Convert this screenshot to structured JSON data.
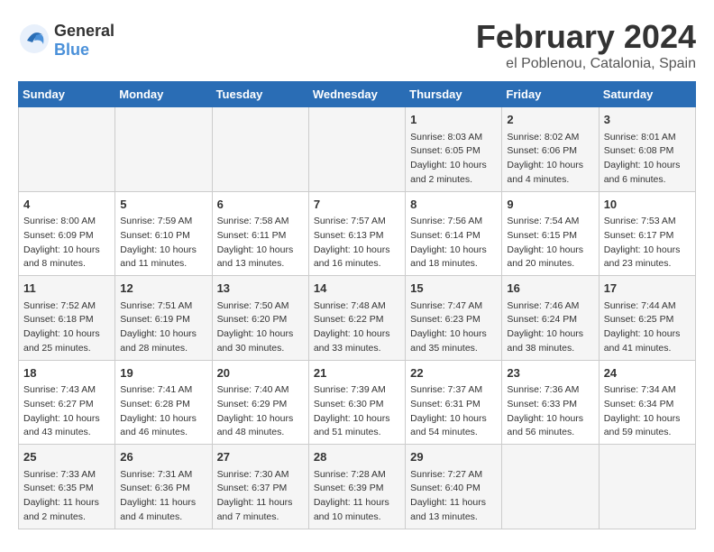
{
  "logo": {
    "general": "General",
    "blue": "Blue"
  },
  "title": "February 2024",
  "subtitle": "el Poblenou, Catalonia, Spain",
  "days_header": [
    "Sunday",
    "Monday",
    "Tuesday",
    "Wednesday",
    "Thursday",
    "Friday",
    "Saturday"
  ],
  "weeks": [
    [
      {
        "day": "",
        "info": ""
      },
      {
        "day": "",
        "info": ""
      },
      {
        "day": "",
        "info": ""
      },
      {
        "day": "",
        "info": ""
      },
      {
        "day": "1",
        "info": "Sunrise: 8:03 AM\nSunset: 6:05 PM\nDaylight: 10 hours\nand 2 minutes."
      },
      {
        "day": "2",
        "info": "Sunrise: 8:02 AM\nSunset: 6:06 PM\nDaylight: 10 hours\nand 4 minutes."
      },
      {
        "day": "3",
        "info": "Sunrise: 8:01 AM\nSunset: 6:08 PM\nDaylight: 10 hours\nand 6 minutes."
      }
    ],
    [
      {
        "day": "4",
        "info": "Sunrise: 8:00 AM\nSunset: 6:09 PM\nDaylight: 10 hours\nand 8 minutes."
      },
      {
        "day": "5",
        "info": "Sunrise: 7:59 AM\nSunset: 6:10 PM\nDaylight: 10 hours\nand 11 minutes."
      },
      {
        "day": "6",
        "info": "Sunrise: 7:58 AM\nSunset: 6:11 PM\nDaylight: 10 hours\nand 13 minutes."
      },
      {
        "day": "7",
        "info": "Sunrise: 7:57 AM\nSunset: 6:13 PM\nDaylight: 10 hours\nand 16 minutes."
      },
      {
        "day": "8",
        "info": "Sunrise: 7:56 AM\nSunset: 6:14 PM\nDaylight: 10 hours\nand 18 minutes."
      },
      {
        "day": "9",
        "info": "Sunrise: 7:54 AM\nSunset: 6:15 PM\nDaylight: 10 hours\nand 20 minutes."
      },
      {
        "day": "10",
        "info": "Sunrise: 7:53 AM\nSunset: 6:17 PM\nDaylight: 10 hours\nand 23 minutes."
      }
    ],
    [
      {
        "day": "11",
        "info": "Sunrise: 7:52 AM\nSunset: 6:18 PM\nDaylight: 10 hours\nand 25 minutes."
      },
      {
        "day": "12",
        "info": "Sunrise: 7:51 AM\nSunset: 6:19 PM\nDaylight: 10 hours\nand 28 minutes."
      },
      {
        "day": "13",
        "info": "Sunrise: 7:50 AM\nSunset: 6:20 PM\nDaylight: 10 hours\nand 30 minutes."
      },
      {
        "day": "14",
        "info": "Sunrise: 7:48 AM\nSunset: 6:22 PM\nDaylight: 10 hours\nand 33 minutes."
      },
      {
        "day": "15",
        "info": "Sunrise: 7:47 AM\nSunset: 6:23 PM\nDaylight: 10 hours\nand 35 minutes."
      },
      {
        "day": "16",
        "info": "Sunrise: 7:46 AM\nSunset: 6:24 PM\nDaylight: 10 hours\nand 38 minutes."
      },
      {
        "day": "17",
        "info": "Sunrise: 7:44 AM\nSunset: 6:25 PM\nDaylight: 10 hours\nand 41 minutes."
      }
    ],
    [
      {
        "day": "18",
        "info": "Sunrise: 7:43 AM\nSunset: 6:27 PM\nDaylight: 10 hours\nand 43 minutes."
      },
      {
        "day": "19",
        "info": "Sunrise: 7:41 AM\nSunset: 6:28 PM\nDaylight: 10 hours\nand 46 minutes."
      },
      {
        "day": "20",
        "info": "Sunrise: 7:40 AM\nSunset: 6:29 PM\nDaylight: 10 hours\nand 48 minutes."
      },
      {
        "day": "21",
        "info": "Sunrise: 7:39 AM\nSunset: 6:30 PM\nDaylight: 10 hours\nand 51 minutes."
      },
      {
        "day": "22",
        "info": "Sunrise: 7:37 AM\nSunset: 6:31 PM\nDaylight: 10 hours\nand 54 minutes."
      },
      {
        "day": "23",
        "info": "Sunrise: 7:36 AM\nSunset: 6:33 PM\nDaylight: 10 hours\nand 56 minutes."
      },
      {
        "day": "24",
        "info": "Sunrise: 7:34 AM\nSunset: 6:34 PM\nDaylight: 10 hours\nand 59 minutes."
      }
    ],
    [
      {
        "day": "25",
        "info": "Sunrise: 7:33 AM\nSunset: 6:35 PM\nDaylight: 11 hours\nand 2 minutes."
      },
      {
        "day": "26",
        "info": "Sunrise: 7:31 AM\nSunset: 6:36 PM\nDaylight: 11 hours\nand 4 minutes."
      },
      {
        "day": "27",
        "info": "Sunrise: 7:30 AM\nSunset: 6:37 PM\nDaylight: 11 hours\nand 7 minutes."
      },
      {
        "day": "28",
        "info": "Sunrise: 7:28 AM\nSunset: 6:39 PM\nDaylight: 11 hours\nand 10 minutes."
      },
      {
        "day": "29",
        "info": "Sunrise: 7:27 AM\nSunset: 6:40 PM\nDaylight: 11 hours\nand 13 minutes."
      },
      {
        "day": "",
        "info": ""
      },
      {
        "day": "",
        "info": ""
      }
    ]
  ]
}
